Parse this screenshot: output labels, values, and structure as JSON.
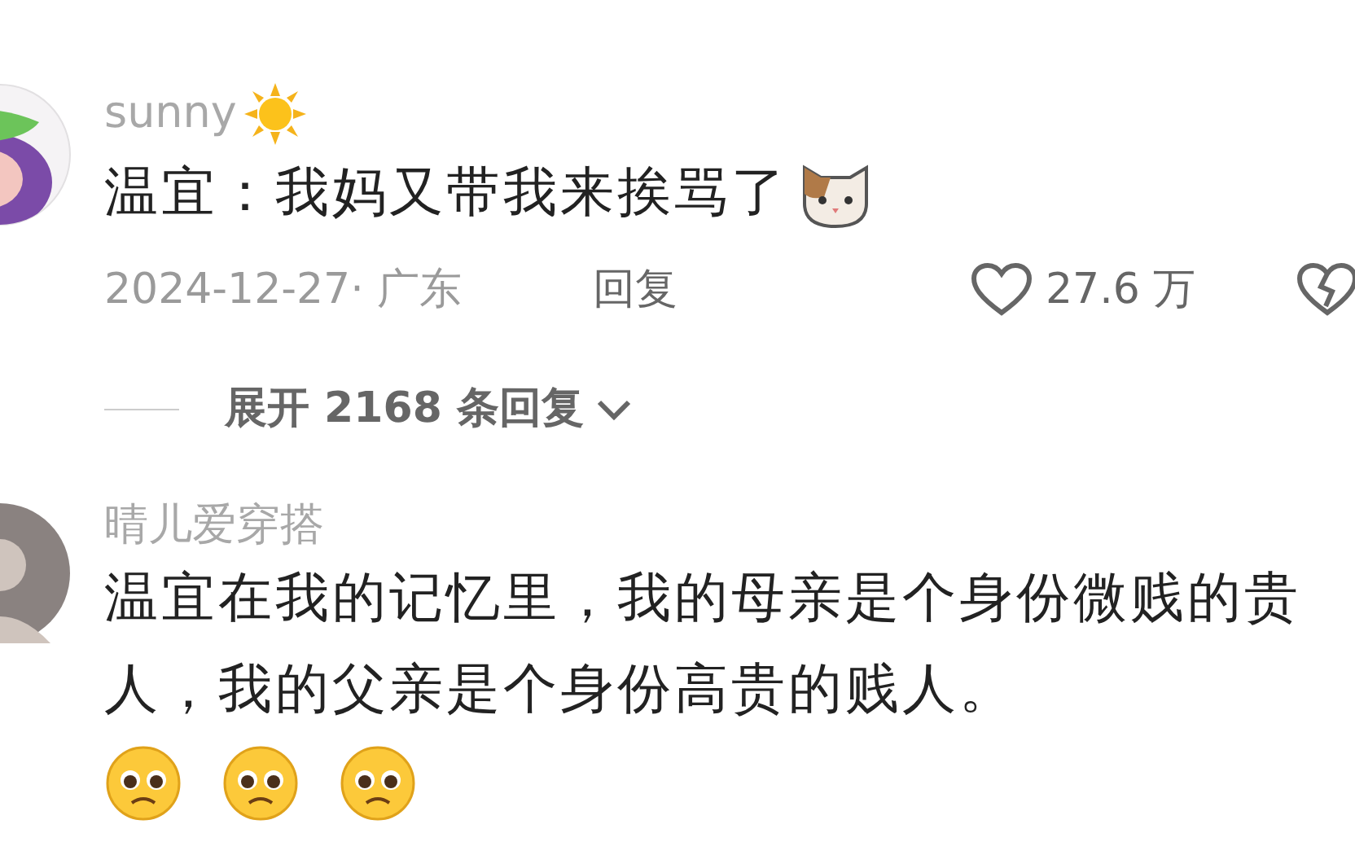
{
  "comments": [
    {
      "kind": "cartoon",
      "username": "sunny",
      "text": "温宜：我妈又带我来挨骂了",
      "date_location": "2024-12-27· 广东",
      "reply_label": "回复",
      "likes": "27.6 万",
      "expand": "展开 2168 条回复"
    },
    {
      "kind": "photo",
      "username": "晴儿爱穿搭",
      "text": "温宜在我的记忆里，我的母亲是个身份微贱的贵人，我的父亲是个身份高贵的贱人。"
    }
  ]
}
